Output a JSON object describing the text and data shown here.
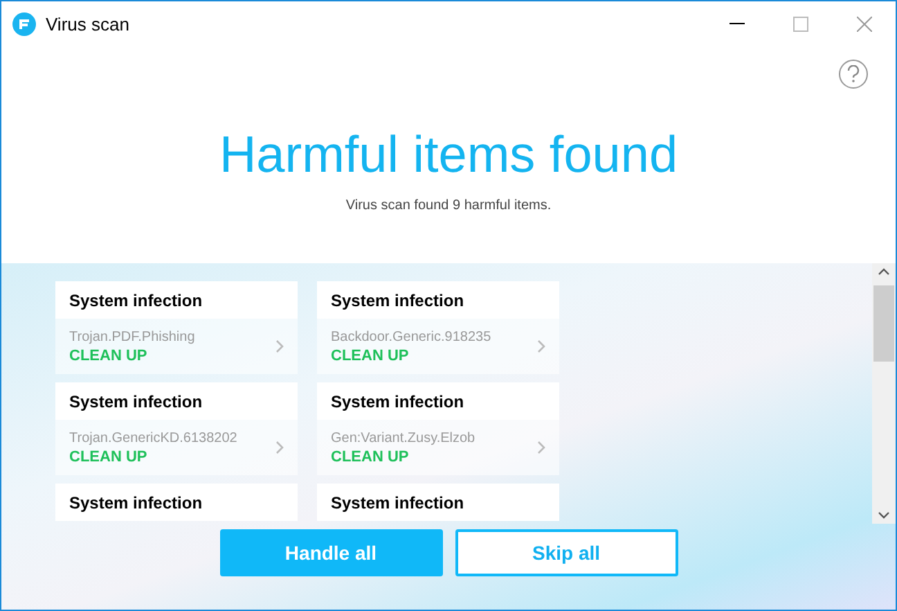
{
  "window": {
    "title": "Virus scan"
  },
  "header": {
    "title": "Harmful items found",
    "subtitle": "Virus scan found 9 harmful items."
  },
  "items": [
    {
      "category": "System infection",
      "threat": "Trojan.PDF.Phishing",
      "action": "CLEAN UP"
    },
    {
      "category": "System infection",
      "threat": "Backdoor.Generic.918235",
      "action": "CLEAN UP"
    },
    {
      "category": "System infection",
      "threat": "Trojan.GenericKD.6138202",
      "action": "CLEAN UP"
    },
    {
      "category": "System infection",
      "threat": "Gen:Variant.Zusy.Elzob",
      "action": "CLEAN UP"
    },
    {
      "category": "System infection"
    },
    {
      "category": "System infection"
    }
  ],
  "buttons": [
    {
      "label": "Handle all",
      "kind": "primary"
    },
    {
      "label": "Skip all",
      "kind": "secondary"
    }
  ]
}
